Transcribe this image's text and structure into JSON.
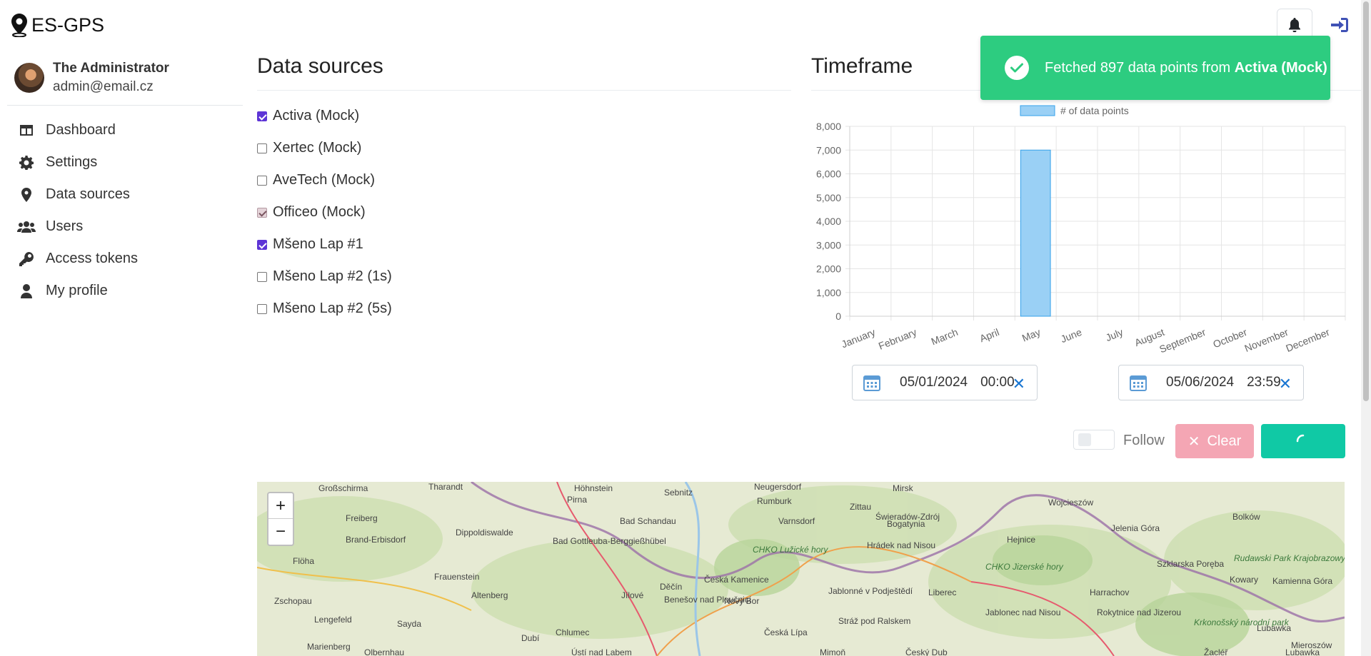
{
  "app": {
    "title": "ES-GPS"
  },
  "profile": {
    "name": "The Administrator",
    "email": "admin@email.cz"
  },
  "nav": [
    {
      "label": "Dashboard",
      "icon": "dashboard-icon"
    },
    {
      "label": "Settings",
      "icon": "gear-icon"
    },
    {
      "label": "Data sources",
      "icon": "map-pin-icon"
    },
    {
      "label": "Users",
      "icon": "users-icon"
    },
    {
      "label": "Access tokens",
      "icon": "key-icon"
    },
    {
      "label": "My profile",
      "icon": "user-icon"
    }
  ],
  "sections": {
    "data_sources": "Data sources",
    "timeframe": "Timeframe"
  },
  "sources": [
    {
      "label": "Activa (Mock)",
      "state": "checked"
    },
    {
      "label": "Xertec (Mock)",
      "state": "unchecked"
    },
    {
      "label": "AveTech (Mock)",
      "state": "unchecked"
    },
    {
      "label": "Officeo (Mock)",
      "state": "checked-disabled"
    },
    {
      "label": "Mšeno Lap #1",
      "state": "checked"
    },
    {
      "label": "Mšeno Lap #2 (1s)",
      "state": "unchecked"
    },
    {
      "label": "Mšeno Lap #2 (5s)",
      "state": "unchecked"
    }
  ],
  "chart_data": {
    "type": "bar",
    "categories": [
      "January",
      "February",
      "March",
      "April",
      "May",
      "June",
      "July",
      "August",
      "September",
      "October",
      "November",
      "December"
    ],
    "series": [
      {
        "name": "# of data points",
        "values": [
          0,
          0,
          0,
          0,
          7000,
          0,
          0,
          0,
          0,
          0,
          0,
          0
        ],
        "color": "#9ad0f5"
      }
    ],
    "yticks": [
      0,
      1000,
      2000,
      3000,
      4000,
      5000,
      6000,
      7000,
      8000
    ],
    "ylim": [
      0,
      8000
    ],
    "grid": true,
    "legend": "top"
  },
  "timeframe": {
    "from": {
      "date": "05/01/2024",
      "time": "00:00"
    },
    "to": {
      "date": "05/06/2024",
      "time": "23:59"
    }
  },
  "controls": {
    "follow_label": "Follow",
    "clear_label": "Clear"
  },
  "toast": {
    "prefix": "Fetched 897 data points from ",
    "source": "Activa (Mock)"
  },
  "map": {
    "zoom_in": "+",
    "zoom_out": "−",
    "labels": [
      {
        "text": "Großschirma"
      },
      {
        "text": "Tharandt"
      },
      {
        "text": "Höhnstein"
      },
      {
        "text": "Sebnitz"
      },
      {
        "text": "Neugersdorf"
      },
      {
        "text": "Rumburk"
      },
      {
        "text": "Mirsk"
      },
      {
        "text": "Wojcieszów"
      },
      {
        "text": "Freiberg"
      },
      {
        "text": "Pirna"
      },
      {
        "text": "Bad Schandau"
      },
      {
        "text": "Varnsdorf"
      },
      {
        "text": "Zittau"
      },
      {
        "text": "Bogatynia"
      },
      {
        "text": "Świeradów-Zdrój"
      },
      {
        "text": "Jelenia Góra"
      },
      {
        "text": "Bolków"
      },
      {
        "text": "Brand-Erbisdorf"
      },
      {
        "text": "Dippoldiswalde"
      },
      {
        "text": "Bad Gottleuba-Berggießhübel"
      },
      {
        "text": "CHKO Lužické hory"
      },
      {
        "text": "Hrádek nad Nisou"
      },
      {
        "text": "Hejnice"
      },
      {
        "text": "Szklarska Poręba"
      },
      {
        "text": "Rudawski Park Krajobrazowy"
      },
      {
        "text": "Flöha"
      },
      {
        "text": "Frauenstein"
      },
      {
        "text": "CHKO Jizerské hory"
      },
      {
        "text": "Harrachov"
      },
      {
        "text": "Kowary"
      },
      {
        "text": "Kamienna Góra"
      },
      {
        "text": "Zschopau"
      },
      {
        "text": "Altenberg"
      },
      {
        "text": "Jílové"
      },
      {
        "text": "Děčín"
      },
      {
        "text": "Česká Kamenice"
      },
      {
        "text": "Benešov nad Ploučnicí"
      },
      {
        "text": "Nový Bor"
      },
      {
        "text": "Jablonné v Podještědí"
      },
      {
        "text": "Liberec"
      },
      {
        "text": "Jablonec nad Nisou"
      },
      {
        "text": "Rokytnice nad Jizerou"
      },
      {
        "text": "Krkonošský národní park"
      },
      {
        "text": "Lubawka"
      },
      {
        "text": "Lengefeld"
      },
      {
        "text": "Sayda"
      },
      {
        "text": "Chlumec"
      },
      {
        "text": "Dubí"
      },
      {
        "text": "Česká Lípa"
      },
      {
        "text": "Stráž pod Ralskem"
      },
      {
        "text": "Žacléř"
      },
      {
        "text": "Mieroszów"
      },
      {
        "text": "Olbernhau"
      },
      {
        "text": "Marienberg"
      },
      {
        "text": "Ústí nad Labem"
      },
      {
        "text": "Mimoň"
      },
      {
        "text": "Český Dub"
      },
      {
        "text": "Lubawka"
      }
    ]
  }
}
